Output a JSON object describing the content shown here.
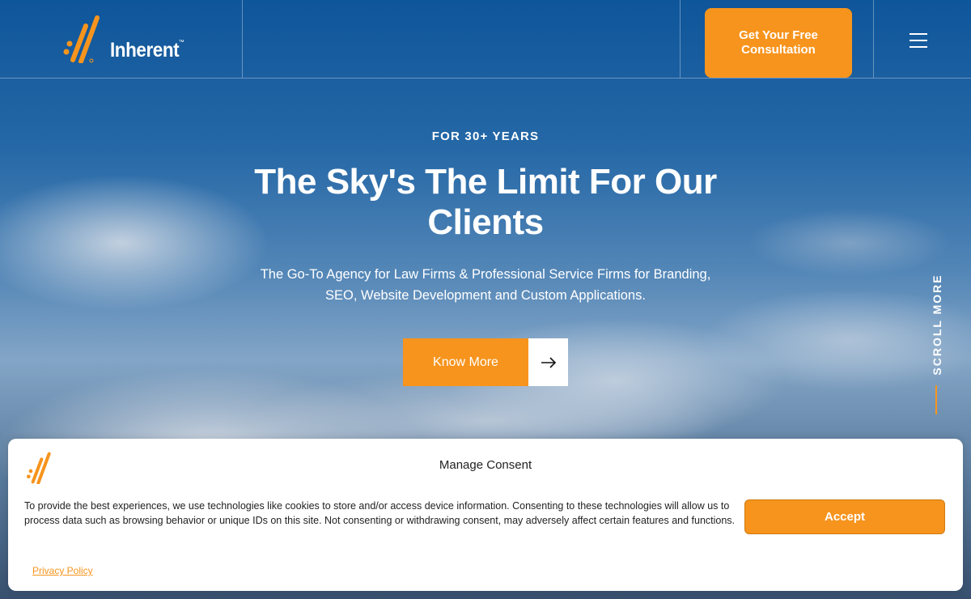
{
  "brand": {
    "name": "Inherent",
    "trademark": "™",
    "accent_color": "#f7941d"
  },
  "header": {
    "cta_label": "Get Your Free Consultation",
    "menu_icon": "hamburger-menu-icon"
  },
  "hero": {
    "eyebrow": "FOR 30+ YEARS",
    "title": "The Sky's The Limit For Our Clients",
    "subtitle": "The Go-To Agency for Law Firms & Professional Service Firms for Branding, SEO, Website Development and Custom Applications.",
    "button_label": "Know More",
    "button_icon": "arrow-right-icon",
    "scroll_label": "SCROLL MORE"
  },
  "consent": {
    "title": "Manage Consent",
    "body": "To provide the best experiences, we use technologies like cookies to store and/or access device information. Consenting to these technologies will allow us to process data such as browsing behavior or unique IDs on this site. Not consenting or withdrawing consent, may adversely affect certain features and functions.",
    "accept_label": "Accept",
    "privacy_label": "Privacy Policy"
  }
}
